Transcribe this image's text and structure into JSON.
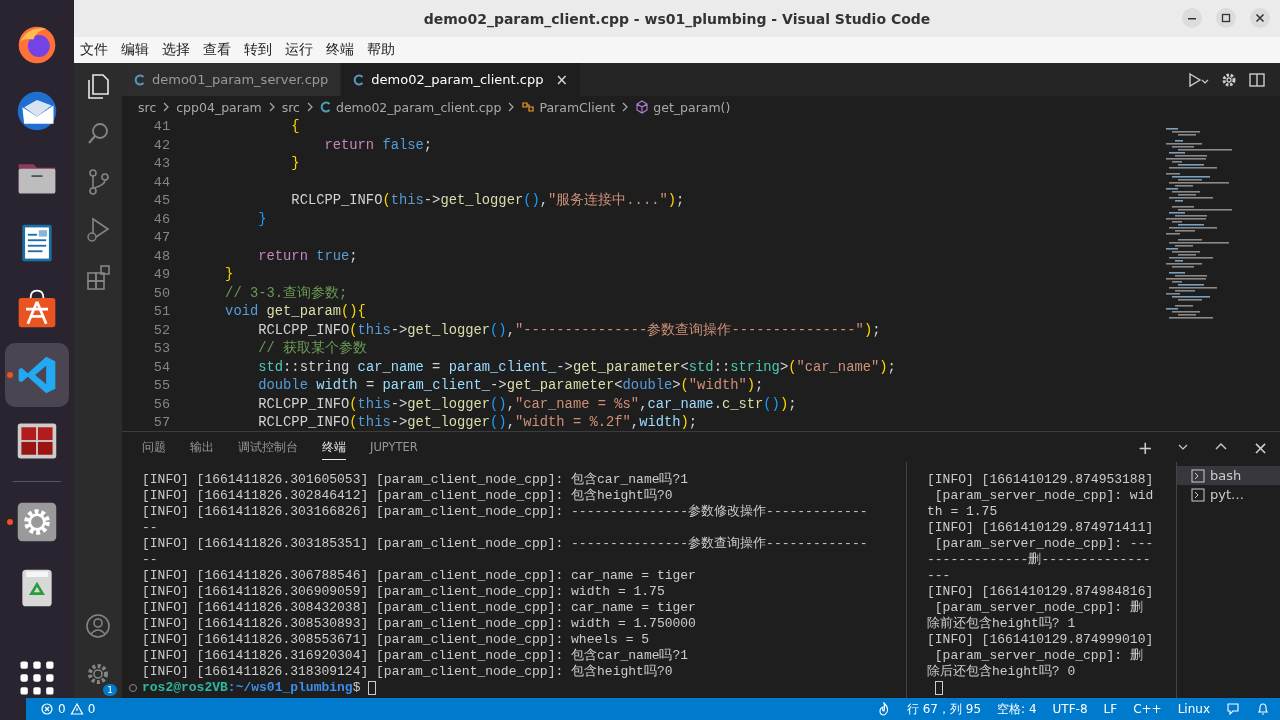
{
  "window": {
    "title": "demo02_param_client.cpp - ws01_plumbing - Visual Studio Code"
  },
  "dock": [
    {
      "kind": "browser",
      "running": false,
      "selected": false
    },
    {
      "kind": "mail",
      "running": false,
      "selected": false
    },
    {
      "kind": "files",
      "running": false,
      "selected": false
    },
    {
      "kind": "writer",
      "running": false,
      "selected": false
    },
    {
      "kind": "store",
      "running": false,
      "selected": false
    },
    {
      "kind": "code",
      "running": true,
      "selected": true
    },
    {
      "kind": "terminal",
      "running": false,
      "selected": false
    },
    {
      "kind": "settings",
      "running": true,
      "selected": false
    },
    {
      "kind": "trash",
      "running": false,
      "selected": false
    },
    {
      "kind": "apps",
      "running": false,
      "selected": false
    }
  ],
  "menu": [
    "文件",
    "编辑",
    "选择",
    "查看",
    "转到",
    "运行",
    "终端",
    "帮助"
  ],
  "activity_bar": {
    "items": [
      {
        "kind": "explorer",
        "selected": true
      },
      {
        "kind": "search",
        "selected": false
      },
      {
        "kind": "source_control",
        "selected": false
      },
      {
        "kind": "run",
        "selected": false
      },
      {
        "kind": "extensions",
        "selected": false
      }
    ],
    "settings_badge": "1"
  },
  "editor_tabs": [
    {
      "label": "demo01_param_server.cpp",
      "selected": false
    },
    {
      "label": "demo02_param_client.cpp",
      "selected": true,
      "close": "×"
    }
  ],
  "breadcrumbs": [
    {
      "label": "src",
      "kind": "folder"
    },
    {
      "label": "cpp04_param",
      "kind": "folder"
    },
    {
      "label": "src",
      "kind": "folder"
    },
    {
      "label": "demo02_param_client.cpp",
      "kind": "file"
    },
    {
      "label": "ParamClient",
      "kind": "class"
    },
    {
      "label": "get_param()",
      "kind": "method"
    }
  ],
  "code": [
    {
      "number": "41",
      "tokens": [
        {
          "kind": "bracket1",
          "text": "            {"
        }
      ]
    },
    {
      "number": "42",
      "tokens": [
        {
          "kind": "control",
          "text": "                return"
        },
        {
          "kind": "keyword",
          "text": " false"
        },
        {
          "kind": "plain",
          "text": ";"
        }
      ]
    },
    {
      "number": "43",
      "tokens": [
        {
          "kind": "bracket1",
          "text": "            }"
        }
      ]
    },
    {
      "number": "44"
    },
    {
      "number": "45",
      "tokens": [
        {
          "kind": "plain",
          "text": "            RCLCPP_INFO"
        },
        {
          "kind": "bracket1",
          "text": "("
        },
        {
          "kind": "keyword",
          "text": "this"
        },
        {
          "kind": "plain",
          "text": "->"
        },
        {
          "kind": "function",
          "text": "get_logger"
        },
        {
          "kind": "bracket2",
          "text": "()"
        },
        {
          "kind": "plain",
          "text": ","
        },
        {
          "kind": "string",
          "text": "\"服务连接中....\""
        },
        {
          "kind": "bracket1",
          "text": ")"
        },
        {
          "kind": "plain",
          "text": ";"
        }
      ]
    },
    {
      "number": "46",
      "tokens": [
        {
          "kind": "bracket2",
          "text": "        }"
        }
      ]
    },
    {
      "number": "47"
    },
    {
      "number": "48",
      "tokens": [
        {
          "kind": "control",
          "text": "        return"
        },
        {
          "kind": "keyword",
          "text": " true"
        },
        {
          "kind": "plain",
          "text": ";"
        }
      ]
    },
    {
      "number": "49",
      "tokens": [
        {
          "kind": "bracket1",
          "text": "    }"
        }
      ]
    },
    {
      "number": "50",
      "tokens": [
        {
          "kind": "comment",
          "text": "    // 3-3.查询参数;"
        }
      ]
    },
    {
      "number": "51",
      "tokens": [
        {
          "kind": "keyword",
          "text": "    void"
        },
        {
          "kind": "function",
          "text": " get_param"
        },
        {
          "kind": "bracket1",
          "text": "(){"
        }
      ]
    },
    {
      "number": "52",
      "tokens": [
        {
          "kind": "plain",
          "text": "        RCLCPP_INFO"
        },
        {
          "kind": "bracket1",
          "text": "("
        },
        {
          "kind": "keyword",
          "text": "this"
        },
        {
          "kind": "plain",
          "text": "->"
        },
        {
          "kind": "function",
          "text": "get_logger"
        },
        {
          "kind": "bracket2",
          "text": "()"
        },
        {
          "kind": "plain",
          "text": ","
        },
        {
          "kind": "string",
          "text": "\"---------------参数查询操作---------------\""
        },
        {
          "kind": "bracket1",
          "text": ")"
        },
        {
          "kind": "plain",
          "text": ";"
        }
      ]
    },
    {
      "number": "53",
      "tokens": [
        {
          "kind": "comment",
          "text": "        // 获取某个参数"
        }
      ]
    },
    {
      "number": "54",
      "tokens": [
        {
          "kind": "type",
          "text": "        std"
        },
        {
          "kind": "plain",
          "text": "::string"
        },
        {
          "kind": "variable",
          "text": " car_name"
        },
        {
          "kind": "plain",
          "text": " ="
        },
        {
          "kind": "variable",
          "text": " param_client_"
        },
        {
          "kind": "plain",
          "text": "->"
        },
        {
          "kind": "function",
          "text": "get_parameter"
        },
        {
          "kind": "plain",
          "text": "<"
        },
        {
          "kind": "type",
          "text": "std"
        },
        {
          "kind": "plain",
          "text": "::"
        },
        {
          "kind": "type",
          "text": "string"
        },
        {
          "kind": "plain",
          "text": ">"
        },
        {
          "kind": "bracket1",
          "text": "("
        },
        {
          "kind": "string",
          "text": "\"car_name\""
        },
        {
          "kind": "bracket1",
          "text": ")"
        },
        {
          "kind": "plain",
          "text": ";"
        }
      ]
    },
    {
      "number": "55",
      "tokens": [
        {
          "kind": "keyword",
          "text": "        double"
        },
        {
          "kind": "variable",
          "text": " width"
        },
        {
          "kind": "plain",
          "text": " ="
        },
        {
          "kind": "variable",
          "text": " param_client_"
        },
        {
          "kind": "plain",
          "text": "->"
        },
        {
          "kind": "function",
          "text": "get_parameter"
        },
        {
          "kind": "plain",
          "text": "<"
        },
        {
          "kind": "keyword",
          "text": "double"
        },
        {
          "kind": "plain",
          "text": ">"
        },
        {
          "kind": "bracket1",
          "text": "("
        },
        {
          "kind": "string",
          "text": "\"width\""
        },
        {
          "kind": "bracket1",
          "text": ")"
        },
        {
          "kind": "plain",
          "text": ";"
        }
      ]
    },
    {
      "number": "56",
      "tokens": [
        {
          "kind": "plain",
          "text": "        RCLCPP_INFO"
        },
        {
          "kind": "bracket1",
          "text": "("
        },
        {
          "kind": "keyword",
          "text": "this"
        },
        {
          "kind": "plain",
          "text": "->"
        },
        {
          "kind": "function",
          "text": "get_logger"
        },
        {
          "kind": "bracket2",
          "text": "()"
        },
        {
          "kind": "plain",
          "text": ","
        },
        {
          "kind": "string",
          "text": "\"car_name = %s\""
        },
        {
          "kind": "plain",
          "text": ","
        },
        {
          "kind": "variable",
          "text": "car_name"
        },
        {
          "kind": "plain",
          "text": "."
        },
        {
          "kind": "function",
          "text": "c_str"
        },
        {
          "kind": "bracket2",
          "text": "()"
        },
        {
          "kind": "bracket1",
          "text": ")"
        },
        {
          "kind": "plain",
          "text": ";"
        }
      ]
    },
    {
      "number": "57",
      "tokens": [
        {
          "kind": "plain",
          "text": "        RCLCPP_INFO"
        },
        {
          "kind": "bracket1",
          "text": "("
        },
        {
          "kind": "keyword",
          "text": "this"
        },
        {
          "kind": "plain",
          "text": "->"
        },
        {
          "kind": "function",
          "text": "get_logger"
        },
        {
          "kind": "bracket2",
          "text": "()"
        },
        {
          "kind": "plain",
          "text": ","
        },
        {
          "kind": "string",
          "text": "\"width = %.2f\""
        },
        {
          "kind": "plain",
          "text": ","
        },
        {
          "kind": "variable",
          "text": "width"
        },
        {
          "kind": "bracket1",
          "text": ")"
        },
        {
          "kind": "plain",
          "text": ";"
        }
      ]
    }
  ],
  "panel_tabs": [
    {
      "label": "问题",
      "selected": false
    },
    {
      "label": "输出",
      "selected": false
    },
    {
      "label": "调试控制台",
      "selected": false
    },
    {
      "label": "终端",
      "selected": true
    },
    {
      "label": "JUPYTER",
      "selected": false
    }
  ],
  "terminal_actions": {
    "add": "+",
    "close": "×"
  },
  "terminal_left": [
    "[INFO] [1661411826.301605053] [param_client_node_cpp]: 包含car_name吗?1",
    "[INFO] [1661411826.302846412] [param_client_node_cpp]: 包含height吗?0",
    "[INFO] [1661411826.303166826] [param_client_node_cpp]: ---------------参数修改操作-------------",
    "--",
    "[INFO] [1661411826.303185351] [param_client_node_cpp]: ---------------参数查询操作-------------",
    "--",
    "[INFO] [1661411826.306788546] [param_client_node_cpp]: car_name = tiger",
    "[INFO] [1661411826.306909059] [param_client_node_cpp]: width = 1.75",
    "[INFO] [1661411826.308432038] [param_client_node_cpp]: car_name = tiger",
    "[INFO] [1661411826.308530893] [param_client_node_cpp]: width = 1.750000",
    "[INFO] [1661411826.308553671] [param_client_node_cpp]: wheels = 5",
    "[INFO] [1661411826.316920304] [param_client_node_cpp]: 包含car_name吗?1",
    "[INFO] [1661411826.318309124] [param_client_node_cpp]: 包含height吗?0"
  ],
  "prompt": {
    "user": "ros2@ros2VB",
    "path": ":~/ws01_plumbing",
    "symbol": "$"
  },
  "terminal_right": [
    "[INFO] [1661410129.874953188]",
    " [param_server_node_cpp]: wid",
    "th = 1.75",
    "[INFO] [1661410129.874971411]",
    " [param_server_node_cpp]: ---",
    "-------------删--------------",
    "---",
    "[INFO] [1661410129.874984816]",
    " [param_server_node_cpp]: 删",
    "除前还包含height吗? 1",
    "[INFO] [1661410129.874999010]",
    " [param_server_node_cpp]: 删",
    "除后还包含height吗? 0"
  ],
  "terminal_list": [
    {
      "label": "bash",
      "selected": true
    },
    {
      "label": "pyt…",
      "selected": false
    }
  ],
  "status_bar": {
    "errors": "0",
    "warnings": "0",
    "position": "行 67，列 95",
    "indent": "空格: 4",
    "encoding": "UTF-8",
    "eol": "LF",
    "language": "C++",
    "platform": "Linux"
  }
}
